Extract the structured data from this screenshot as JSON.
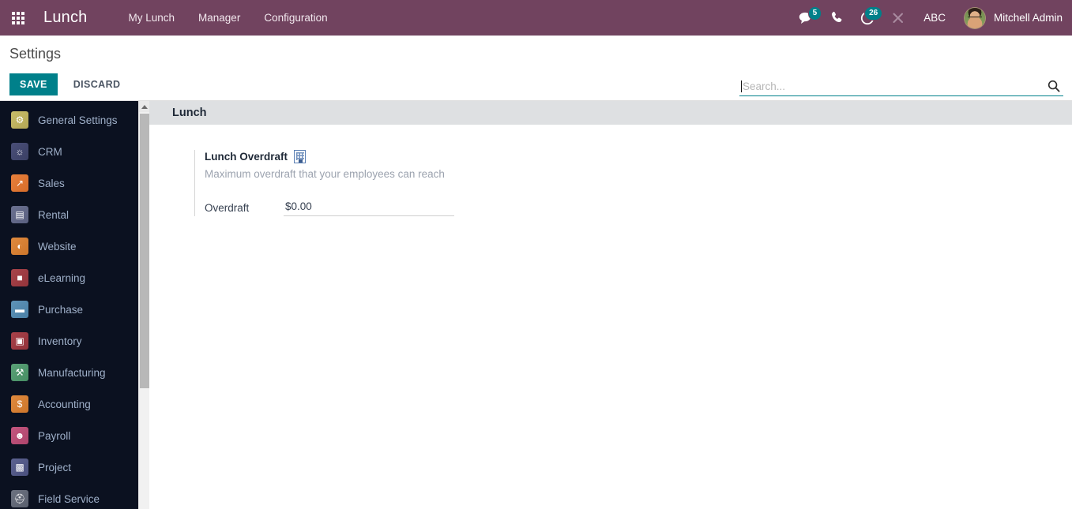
{
  "navbar": {
    "apps_icon": "apps-grid-icon",
    "brand": "Lunch",
    "menus": [
      {
        "label": "My Lunch"
      },
      {
        "label": "Manager"
      },
      {
        "label": "Configuration"
      }
    ],
    "systray": {
      "messages_icon": "messages-icon",
      "messages_count": "5",
      "voip_icon": "phone-icon",
      "activities_icon": "clock-icon",
      "activities_count": "26",
      "debug_icon": "tools-icon",
      "language": "ABC",
      "avatar_icon": "avatar",
      "username": "Mitchell Admin"
    },
    "accent_color": "#71435f",
    "badge_color": "#00808a"
  },
  "control_panel": {
    "title": "Settings",
    "save_label": "SAVE",
    "discard_label": "DISCARD",
    "save_color": "#00808a",
    "search": {
      "placeholder": "Search...",
      "value": "",
      "icon": "search-icon"
    }
  },
  "sidebar": {
    "items": [
      {
        "label": "General Settings",
        "icon": "gear-icon",
        "glyph": "⚙",
        "color1": "#c9bd6a",
        "color2": "#b3a755"
      },
      {
        "label": "CRM",
        "icon": "handshake-icon",
        "glyph": "☺",
        "color1": "#4a4f78",
        "color2": "#3b4065"
      },
      {
        "label": "Sales",
        "icon": "chart-up-icon",
        "glyph": "↗",
        "color1": "#e8803c",
        "color2": "#d76d2a"
      },
      {
        "label": "Rental",
        "icon": "contract-icon",
        "glyph": "▤",
        "color1": "#6b7190",
        "color2": "#5a6080"
      },
      {
        "label": "Website",
        "icon": "globe-icon",
        "glyph": "◔",
        "color1": "#e08a3e",
        "color2": "#cd762b"
      },
      {
        "label": "eLearning",
        "icon": "presentation-icon",
        "glyph": "■",
        "color1": "#a8444b",
        "color2": "#93343b"
      },
      {
        "label": "Purchase",
        "icon": "card-icon",
        "glyph": "▬",
        "color1": "#5e93b8",
        "color2": "#4b80a6"
      },
      {
        "label": "Inventory",
        "icon": "box-icon",
        "glyph": "✉",
        "color1": "#a8424a",
        "color2": "#93323a"
      },
      {
        "label": "Manufacturing",
        "icon": "wrench-icon",
        "glyph": "⚒",
        "color1": "#5aa177",
        "color2": "#478e64"
      },
      {
        "label": "Accounting",
        "icon": "invoice-icon",
        "glyph": "$",
        "color1": "#e08a3e",
        "color2": "#cd762b"
      },
      {
        "label": "Payroll",
        "icon": "employee-icon",
        "glyph": "☻",
        "color1": "#c4567f",
        "color2": "#ae456c"
      },
      {
        "label": "Project",
        "icon": "puzzle-icon",
        "glyph": "▩",
        "color1": "#5c6290",
        "color2": "#4a507e"
      },
      {
        "label": "Field Service",
        "icon": "truck-icon",
        "glyph": "⛑",
        "color1": "#6c7280",
        "color2": "#5a606e"
      }
    ],
    "scrollbar": {
      "up_arrow_icon": "scroll-up-arrow-icon",
      "thumb": "sidebar-scroll-thumb"
    }
  },
  "main": {
    "app_header": "Lunch",
    "setting": {
      "title": "Lunch Overdraft",
      "company_icon": "company-building-icon",
      "description": "Maximum overdraft that your employees can reach",
      "field_label": "Overdraft",
      "field_value": "$0.00"
    }
  }
}
